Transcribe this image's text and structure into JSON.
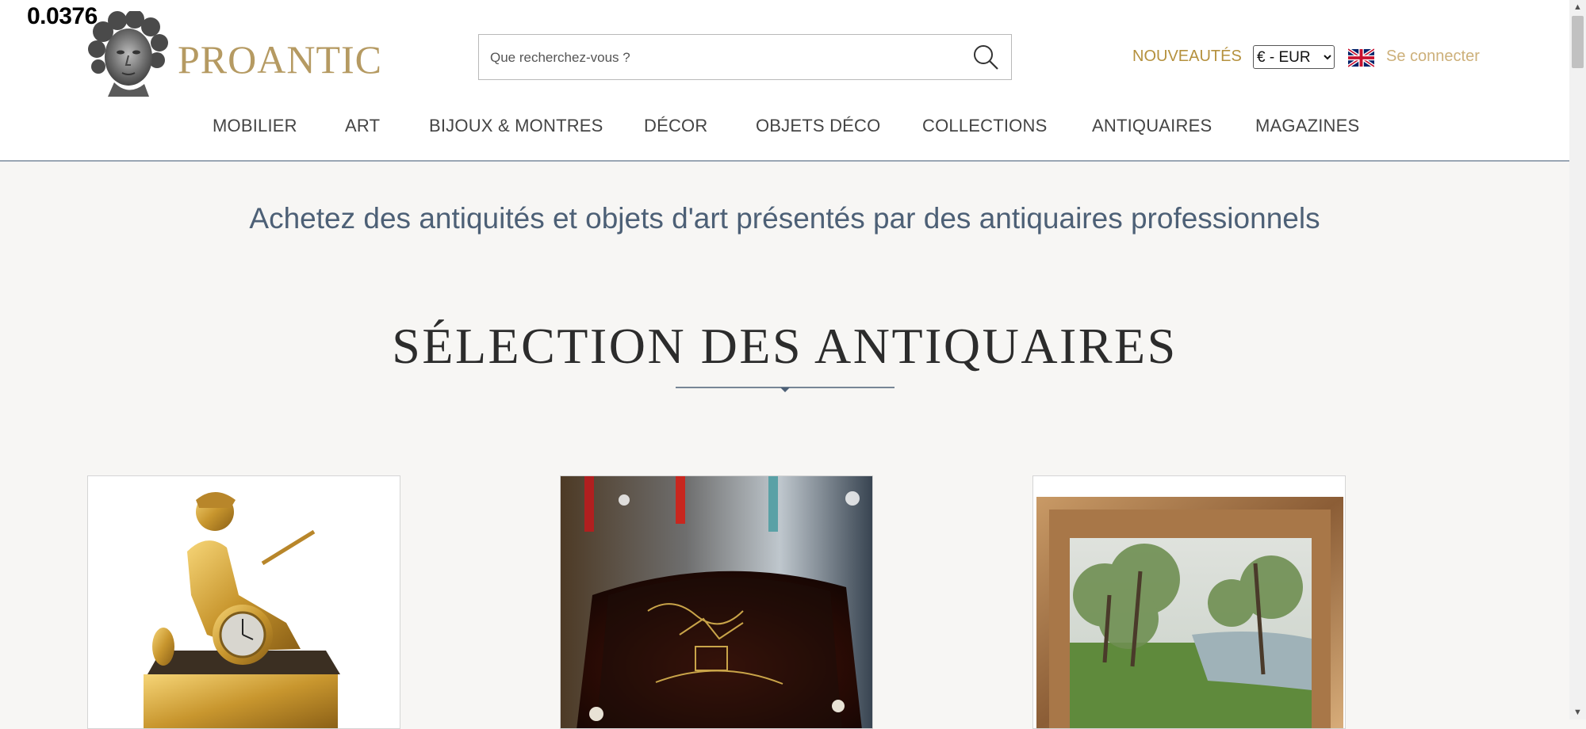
{
  "overlay": {
    "score_text": "0.0376"
  },
  "header": {
    "logo_text": "PROANTIC",
    "search": {
      "placeholder": "Que recherchez-vous ?",
      "value": "",
      "icon": "search-icon"
    },
    "nouveautes_label": "NOUVEAUTÉS",
    "currency": {
      "selected": "€ - EUR",
      "options": [
        "€ - EUR"
      ]
    },
    "language_flag": "uk-flag-icon",
    "login_label": "Se connecter"
  },
  "nav": {
    "items": [
      {
        "label": "MOBILIER"
      },
      {
        "label": "ART"
      },
      {
        "label": "BIJOUX & MONTRES"
      },
      {
        "label": "DÉCOR"
      },
      {
        "label": "OBJETS DÉCO"
      },
      {
        "label": "COLLECTIONS"
      },
      {
        "label": "ANTIQUAIRES"
      },
      {
        "label": "MAGAZINES"
      }
    ]
  },
  "main": {
    "tagline": "Achetez des antiquités et objets d'art présentés par des antiquaires professionnels",
    "section_title": "SÉLECTION DES ANTIQUAIRES",
    "cards": [
      {
        "image": "gilt-bronze-mantel-clock-image"
      },
      {
        "image": "chinoiserie-lacquer-box-image"
      },
      {
        "image": "framed-landscape-painting-image"
      }
    ]
  },
  "colors": {
    "brand_gold": "#b59a62",
    "nouveautes": "#b5913e",
    "tagline": "#4d6076",
    "background": "#f7f6f4"
  }
}
